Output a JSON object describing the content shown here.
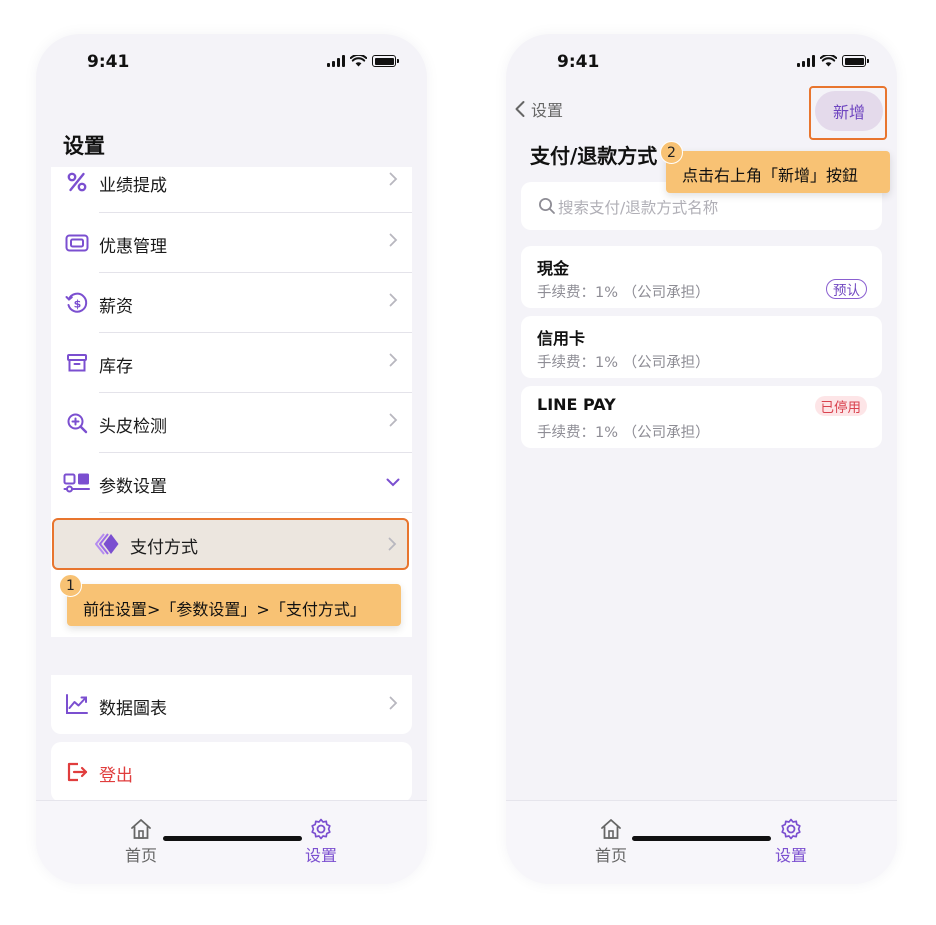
{
  "status": {
    "time": "9:41"
  },
  "left": {
    "title": "设置",
    "menu": [
      {
        "label": "业绩提成",
        "icon": "percent-icon"
      },
      {
        "label": "优惠管理",
        "icon": "ticket-icon"
      },
      {
        "label": "薪资",
        "icon": "salary-icon"
      },
      {
        "label": "库存",
        "icon": "archive-box-icon"
      },
      {
        "label": "头皮检测",
        "icon": "zoom-plus-icon"
      },
      {
        "label": "参数设置",
        "icon": "parameters-icon"
      }
    ],
    "sub_item": {
      "label": "支付方式",
      "icon": "payment-diamond-icon"
    },
    "data_chart": {
      "label": "数据圖表",
      "icon": "line-chart-icon"
    },
    "logout": {
      "label": "登出",
      "icon": "logout-icon"
    },
    "callout": {
      "number": "1",
      "text": "前往设置>「参数设置」>「支付方式」"
    }
  },
  "right": {
    "back_label": "设置",
    "add_label": "新增",
    "title": "支付/退款方式",
    "search_placeholder": "搜索支付/退款方式名称",
    "callout": {
      "number": "2",
      "text": "点击右上角「新增」按鈕"
    },
    "methods": [
      {
        "name": "現金",
        "fee": "手续费：1% （公司承担）",
        "badge": "预认"
      },
      {
        "name": "信用卡",
        "fee": "手续费：1% （公司承担）",
        "badge": ""
      },
      {
        "name": "LINE PAY",
        "fee": "手续费：1% （公司承担）",
        "badge": "已停用"
      }
    ]
  },
  "tabs": [
    {
      "label": "首页",
      "icon": "home-icon"
    },
    {
      "label": "设置",
      "icon": "gear-icon"
    }
  ],
  "colors": {
    "accent": "#7b4fd0",
    "highlight_border": "#e8752e",
    "callout": "#f8c274",
    "danger": "#d9434f"
  }
}
